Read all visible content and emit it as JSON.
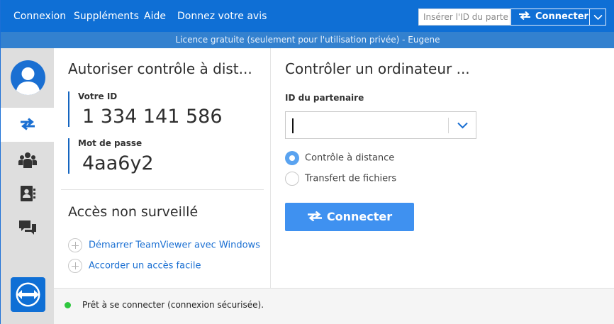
{
  "menu": {
    "items": [
      "Connexion",
      "Suppléments",
      "Aide",
      "Donnez votre avis"
    ],
    "partner_id_placeholder": "Insérer l'ID du parte",
    "connect_label": "Connecter"
  },
  "license_text": "Licence gratuite (seulement pour l'utilisation privée) - Eugene",
  "sidebar": {
    "items": [
      {
        "icon": "arrows-icon",
        "active": true
      },
      {
        "icon": "group-icon",
        "active": false
      },
      {
        "icon": "contacts-icon",
        "active": false
      },
      {
        "icon": "chat-icon",
        "active": false
      }
    ]
  },
  "left_panel": {
    "title": "Autoriser contrôle à dist...",
    "id_label": "Votre ID",
    "id_value": "1 334 141 586",
    "password_label": "Mot de passe",
    "password_value": "4aa6y2",
    "unattended_title": "Accès non surveillé",
    "links": [
      "Démarrer TeamViewer avec Windows",
      "Accorder un accès facile"
    ]
  },
  "right_panel": {
    "title": "Contrôler un ordinateur ...",
    "partner_label": "ID du partenaire",
    "partner_value": "",
    "options": [
      {
        "label": "Contrôle à distance",
        "selected": true
      },
      {
        "label": "Transfert de fichiers",
        "selected": false
      }
    ],
    "connect_label": "Connecter"
  },
  "status": {
    "text": "Prêt à se connecter (connexion sécurisée).",
    "color": "#2ec73e"
  },
  "colors": {
    "accent": "#0f6fd5",
    "license_bar": "#3381cf",
    "button": "#3f91f0"
  }
}
